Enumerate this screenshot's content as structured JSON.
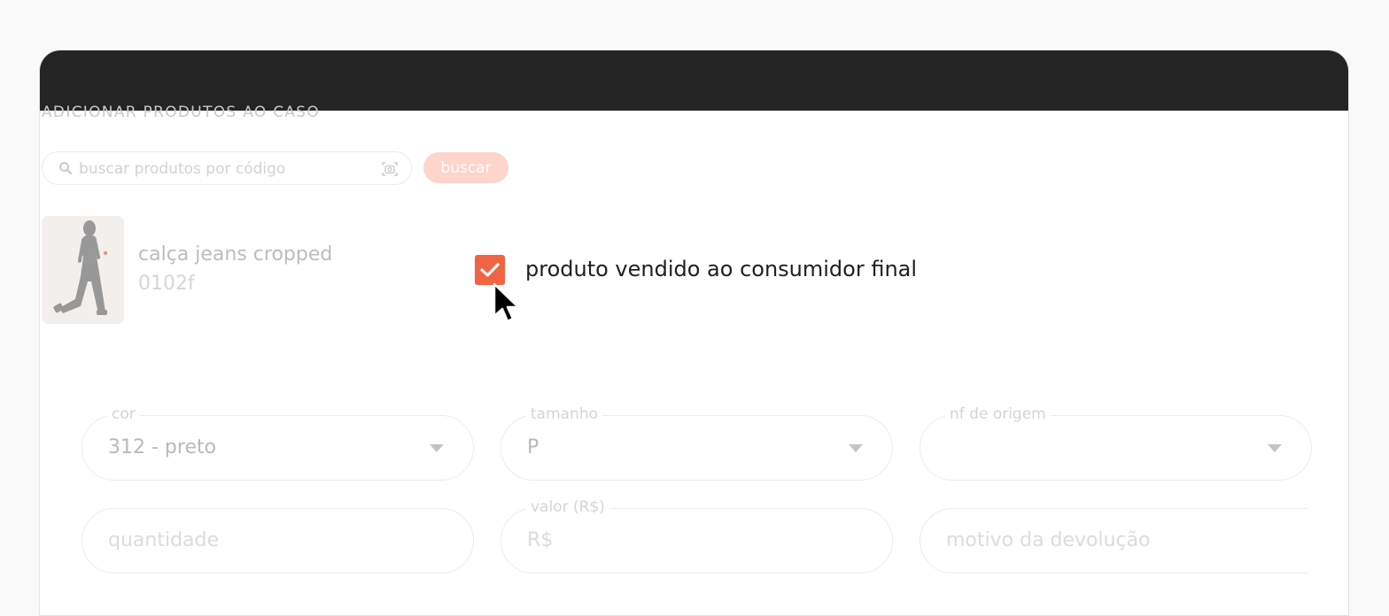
{
  "section": {
    "title": "ADICIONAR PRODUTOS AO CASO"
  },
  "search": {
    "placeholder": "buscar produtos por código",
    "button_label": "buscar"
  },
  "product": {
    "name": "calça jeans cropped",
    "code": "0102f"
  },
  "consumer_checkbox": {
    "label": "produto vendido ao consumidor final",
    "checked": true
  },
  "fields": {
    "cor": {
      "label": "cor",
      "value": "312 - preto"
    },
    "tamanho": {
      "label": "tamanho",
      "value": "P"
    },
    "nf_origem": {
      "label": "nf de origem",
      "value": ""
    },
    "quantidade": {
      "placeholder": "quantidade"
    },
    "valor": {
      "label": "valor (R$)",
      "placeholder": "R$"
    },
    "motivo": {
      "placeholder": "motivo da devolução"
    }
  },
  "colors": {
    "accent": "#f06443",
    "accent_light": "#fdd5cb",
    "titlebar": "#242424"
  },
  "icons": {
    "search": "search-icon",
    "scan": "scan-icon",
    "check": "check-icon",
    "cursor": "cursor-icon",
    "dropdown": "chevron-down-icon"
  }
}
